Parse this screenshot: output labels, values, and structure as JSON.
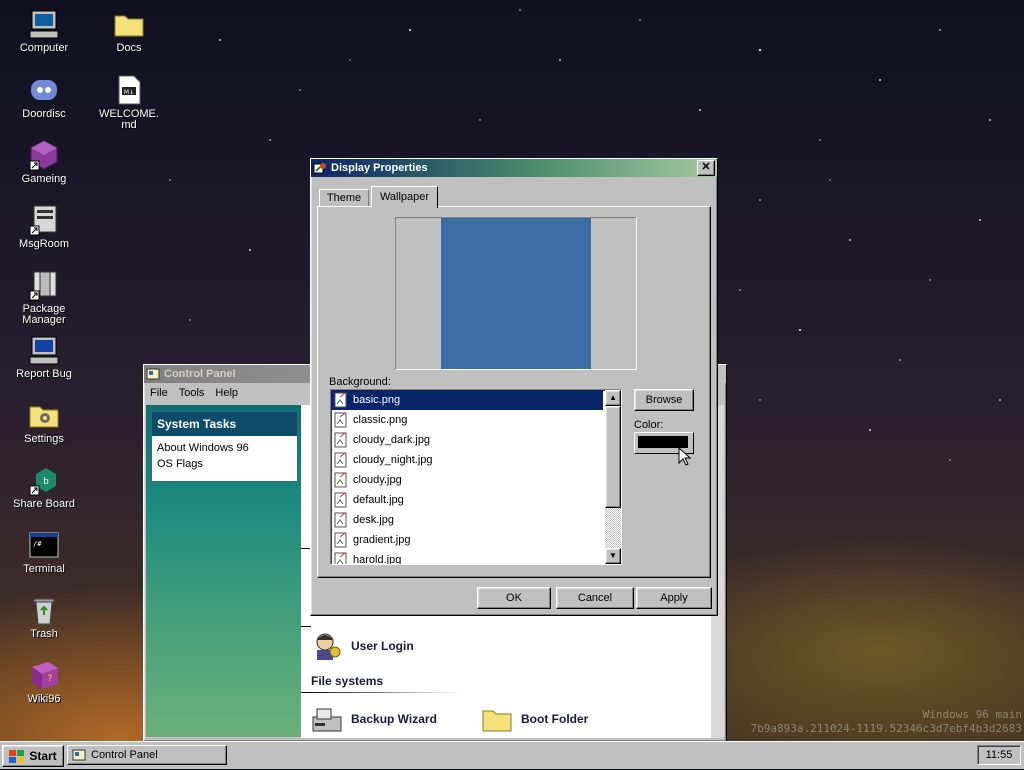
{
  "desktop": {
    "icons": [
      {
        "label": "Computer",
        "icon": "computer-icon"
      },
      {
        "label": "Docs",
        "icon": "folder-icon"
      },
      {
        "label": "Doordisc",
        "icon": "discord-icon"
      },
      {
        "label": "WELCOME.md",
        "icon": "markdown-file-icon"
      },
      {
        "label": "Gameing",
        "icon": "game-cube-icon"
      },
      {
        "label": "MsgRoom",
        "icon": "message-room-icon"
      },
      {
        "label": "Package Manager",
        "icon": "package-icon"
      },
      {
        "label": "Report Bug",
        "icon": "report-bug-icon"
      },
      {
        "label": "Settings",
        "icon": "settings-folder-icon"
      },
      {
        "label": "Share Board",
        "icon": "share-board-icon"
      },
      {
        "label": "Terminal",
        "icon": "terminal-icon"
      },
      {
        "label": "Trash",
        "icon": "trash-icon"
      },
      {
        "label": "Wiki96",
        "icon": "wiki-book-icon"
      }
    ],
    "watermark_line1": "Windows 96 main",
    "watermark_line2": "7b9a893a.211024-1119.52346c3d7ebf4b3d2683"
  },
  "control_panel": {
    "title": "Control Panel",
    "menu": [
      "File",
      "Tools",
      "Help"
    ],
    "system_tasks": {
      "header": "System Tasks",
      "items": [
        "About Windows 96",
        "OS Flags"
      ]
    },
    "user_login": "User Login",
    "file_systems_header": "File systems",
    "backup_wizard": "Backup Wizard",
    "boot_folder": "Boot Folder"
  },
  "display_properties": {
    "title": "Display Properties",
    "close": "✕",
    "tabs": [
      "Theme",
      "Wallpaper"
    ],
    "active_tab": "Wallpaper",
    "preview_color": "#3a6ea5",
    "background_label": "Background:",
    "files": [
      "basic.png",
      "classic.png",
      "cloudy_dark.jpg",
      "cloudy_night.jpg",
      "cloudy.jpg",
      "default.jpg",
      "desk.jpg",
      "gradient.jpg",
      "harold.jpg"
    ],
    "selected_file": "basic.png",
    "browse": "Browse",
    "color_label": "Color:",
    "color_value": "#000000",
    "ok": "OK",
    "cancel": "Cancel",
    "apply": "Apply"
  },
  "taskbar": {
    "start": "Start",
    "task": "Control Panel",
    "clock": "11:55"
  }
}
